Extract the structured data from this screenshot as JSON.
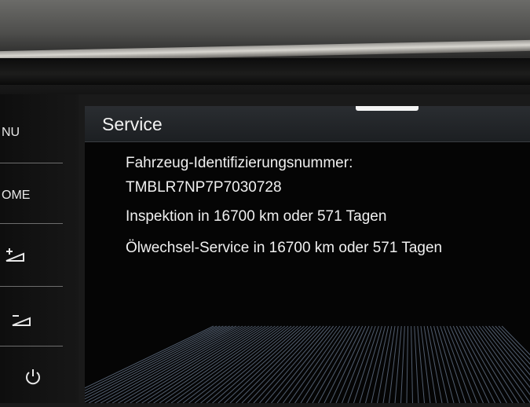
{
  "sidebar": {
    "menu_label": "NU",
    "home_label": "OME",
    "icons": [
      "brightness-up-icon",
      "brightness-down-icon",
      "power-icon"
    ]
  },
  "screen": {
    "title": "Service",
    "vin_label": "Fahrzeug-Identifizierungsnummer:",
    "vin_value": "TMBLR7NP7P7030728",
    "inspection": "Inspektion in 16700 km oder 571 Tagen",
    "oil_service": "Ölwechsel-Service in 16700 km oder 571 Tagen"
  },
  "colors": {
    "background": "#050505",
    "text": "#f0f0f0",
    "titlebar": "#22252a"
  }
}
